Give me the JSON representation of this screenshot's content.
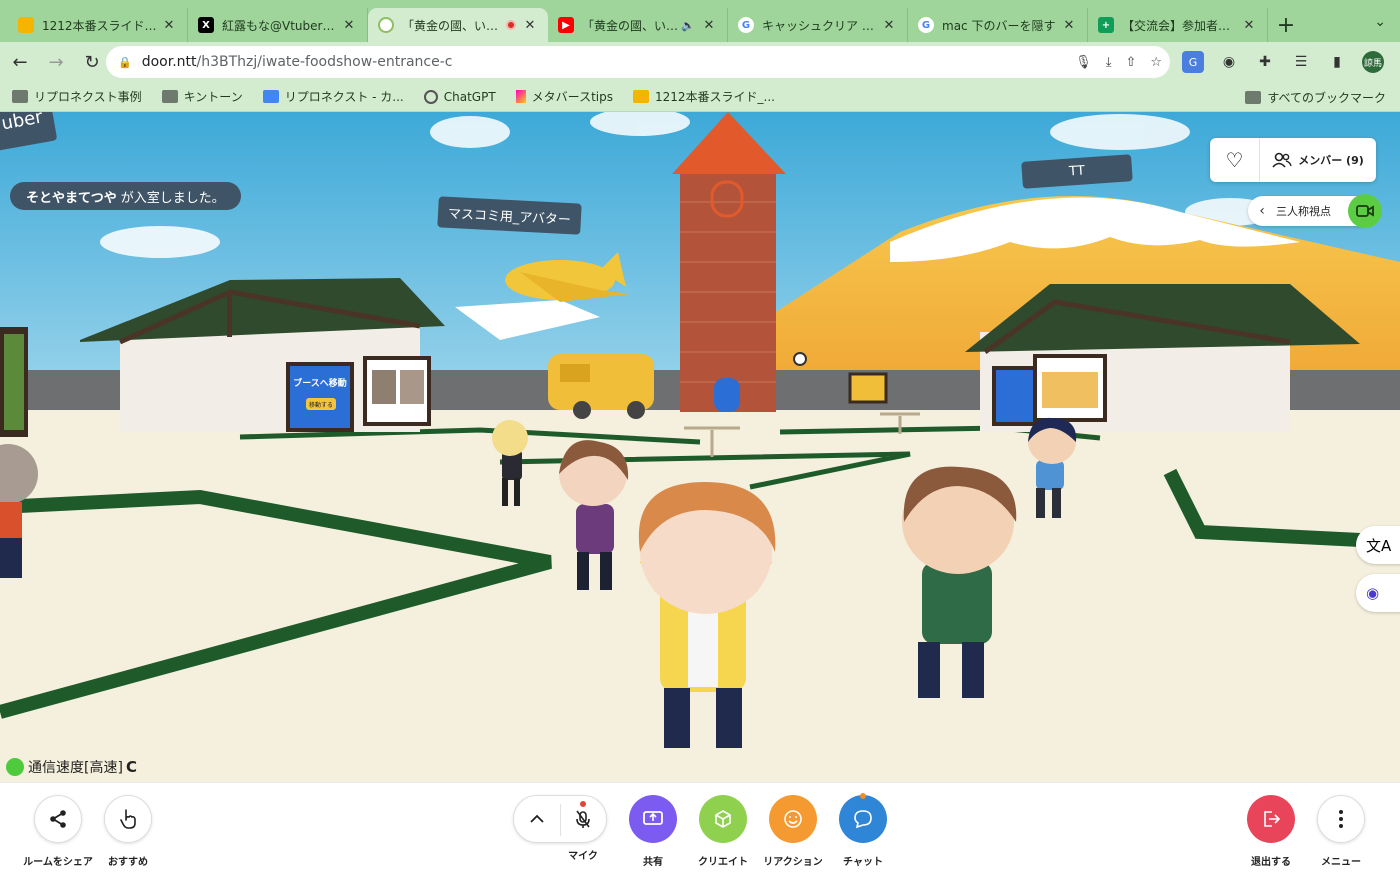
{
  "browser": {
    "tabs": [
      {
        "title": "1212本番スライド_【交",
        "favicon": "slides",
        "color": "#f4b400",
        "active": false
      },
      {
        "title": "紅露もな@Vtuber（@",
        "favicon": "x-logo",
        "color": "#000000",
        "active": false
      },
      {
        "title": "「黄金の國、いわて",
        "favicon": "door-logo",
        "color": "#8fbf5f",
        "active": true,
        "recording": true
      },
      {
        "title": "「黄金の國、いわて",
        "favicon": "youtube",
        "color": "#ff0000",
        "active": false,
        "audio": true
      },
      {
        "title": "キャッシュクリア pc -",
        "favicon": "google",
        "color": "#4285f4",
        "active": false
      },
      {
        "title": "mac 下のバーを隠す",
        "favicon": "google",
        "color": "#4285f4",
        "active": false
      },
      {
        "title": "【交流会】参加者一覧",
        "favicon": "sheets",
        "color": "#0f9d58",
        "active": false
      }
    ],
    "new_tab_glyph": "+",
    "tab_menu_glyph": "⌄",
    "url_host": "door.ntt",
    "url_path": "/h3BThzj/iwate-foodshow-entrance-c",
    "profile_label": "諒馬",
    "bookmarks": [
      {
        "label": "リプロネクスト事例",
        "icon": "folder"
      },
      {
        "label": "キントーン",
        "icon": "folder"
      },
      {
        "label": "リプロネクスト - カ...",
        "icon": "calendar"
      },
      {
        "label": "ChatGPT",
        "icon": "chatgpt"
      },
      {
        "label": "メタバースtips",
        "icon": "pen"
      },
      {
        "label": "1212本番スライド_...",
        "icon": "slides"
      }
    ],
    "all_bookmarks_label": "すべてのブックマーク"
  },
  "scene": {
    "join_message_name": "そとやまてつや",
    "join_message_suffix": "が入室しました。",
    "nametags": [
      {
        "label": "マスコミ用_アバター"
      },
      {
        "label": "TT"
      },
      {
        "label": "uber"
      }
    ],
    "booth_sign_title": "ブースへ移動",
    "booth_sign_button": "移動する",
    "speed_label": "通信速度",
    "speed_value": "[高速]",
    "members_label": "メンバー (9)",
    "view_mode_label": "三人称視点"
  },
  "bottom_bar": {
    "share_room": "ルームをシェア",
    "recommend": "おすすめ",
    "mic": "マイク",
    "share": "共有",
    "create": "クリエイト",
    "reaction": "リアクション",
    "chat": "チャット",
    "leave": "退出する",
    "menu": "メニュー",
    "colors": {
      "share": "#7c5cf0",
      "create": "#8fd14f",
      "reaction": "#f59a30",
      "chat": "#2f86d6",
      "leave": "#e8455a"
    }
  }
}
